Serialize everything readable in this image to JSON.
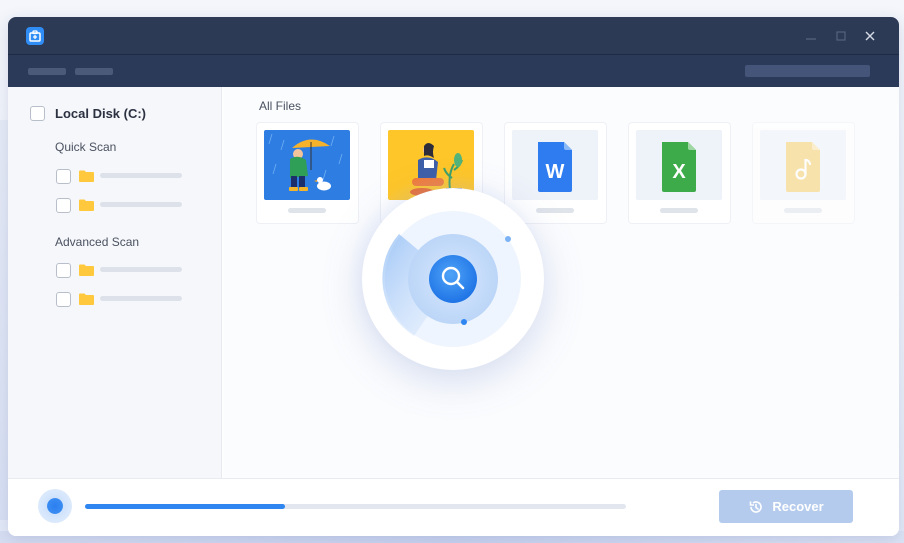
{
  "sidebar": {
    "disk_label": "Local Disk (C:)",
    "sections": [
      {
        "label": "Quick Scan"
      },
      {
        "label": "Advanced Scan"
      }
    ]
  },
  "content": {
    "header": "All Files",
    "files": [
      {
        "type": "image",
        "icon": "umbrella-illustration-icon"
      },
      {
        "type": "image",
        "icon": "reading-person-illustration-icon"
      },
      {
        "type": "document",
        "icon": "word-file-icon",
        "letter": "W"
      },
      {
        "type": "spreadsheet",
        "icon": "excel-file-icon",
        "letter": "X"
      },
      {
        "type": "audio",
        "icon": "music-file-icon"
      }
    ]
  },
  "scan": {
    "progress": 0.37
  },
  "footer": {
    "recover_label": "Recover"
  },
  "colors": {
    "titlebar": "#2c3a55",
    "accent": "#2f86f0",
    "recover_disabled": "#b4cbed",
    "folder": "#ffc83d"
  }
}
